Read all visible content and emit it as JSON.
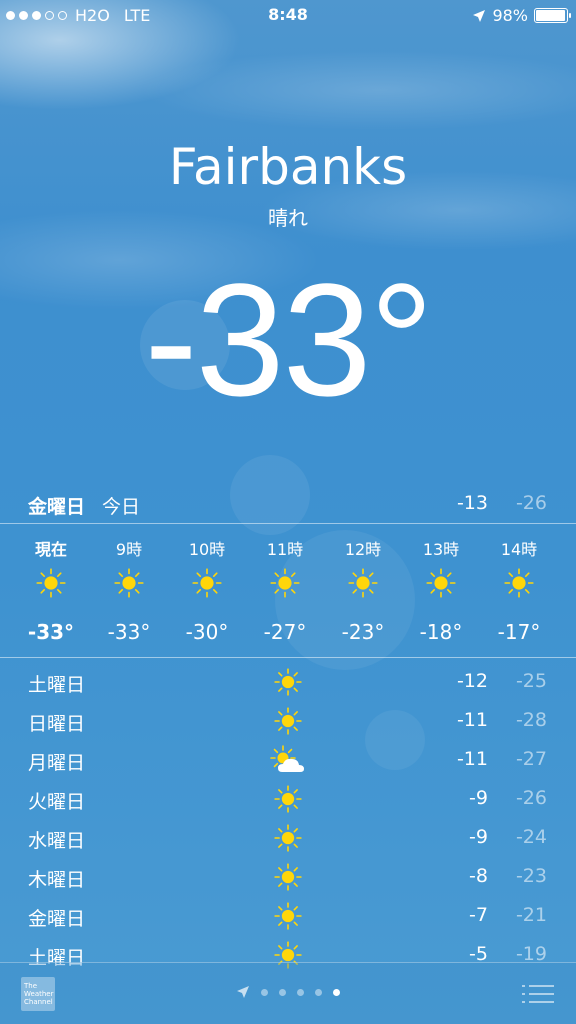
{
  "status": {
    "carrier": "H2O",
    "network": "LTE",
    "time": "8:48",
    "battery": "98%",
    "signal_filled": 3,
    "signal_total": 5
  },
  "location": {
    "city": "Fairbanks",
    "condition": "晴れ",
    "temperature": "-33°"
  },
  "today": {
    "day": "金曜日",
    "label": "今日",
    "high": "-13",
    "low": "-26"
  },
  "hourly": [
    {
      "hour": "現在",
      "icon": "sun-icon",
      "temp": "-33°"
    },
    {
      "hour": "9時",
      "icon": "sun-icon",
      "temp": "-33°"
    },
    {
      "hour": "10時",
      "icon": "sun-icon",
      "temp": "-30°"
    },
    {
      "hour": "11時",
      "icon": "sun-icon",
      "temp": "-27°"
    },
    {
      "hour": "12時",
      "icon": "sun-icon",
      "temp": "-23°"
    },
    {
      "hour": "13時",
      "icon": "sun-icon",
      "temp": "-18°"
    },
    {
      "hour": "14時",
      "icon": "sun-icon",
      "temp": "-17°"
    }
  ],
  "daily": [
    {
      "day": "土曜日",
      "icon": "sun-icon",
      "high": "-12",
      "low": "-25"
    },
    {
      "day": "日曜日",
      "icon": "sun-icon",
      "high": "-11",
      "low": "-28"
    },
    {
      "day": "月曜日",
      "icon": "partly-cloudy-icon",
      "high": "-11",
      "low": "-27"
    },
    {
      "day": "火曜日",
      "icon": "sun-icon",
      "high": "-9",
      "low": "-26"
    },
    {
      "day": "水曜日",
      "icon": "sun-icon",
      "high": "-9",
      "low": "-24"
    },
    {
      "day": "木曜日",
      "icon": "sun-icon",
      "high": "-8",
      "low": "-23"
    },
    {
      "day": "金曜日",
      "icon": "sun-icon",
      "high": "-7",
      "low": "-21"
    },
    {
      "day": "土曜日",
      "icon": "sun-icon",
      "high": "-5",
      "low": "-19"
    }
  ],
  "toolbar": {
    "logo_lines": [
      "The",
      "Weather",
      "Channel"
    ],
    "page_count": 5,
    "active_page": 4
  },
  "colors": {
    "sun": "#ffd60a",
    "sky": "#3e8fcf"
  }
}
